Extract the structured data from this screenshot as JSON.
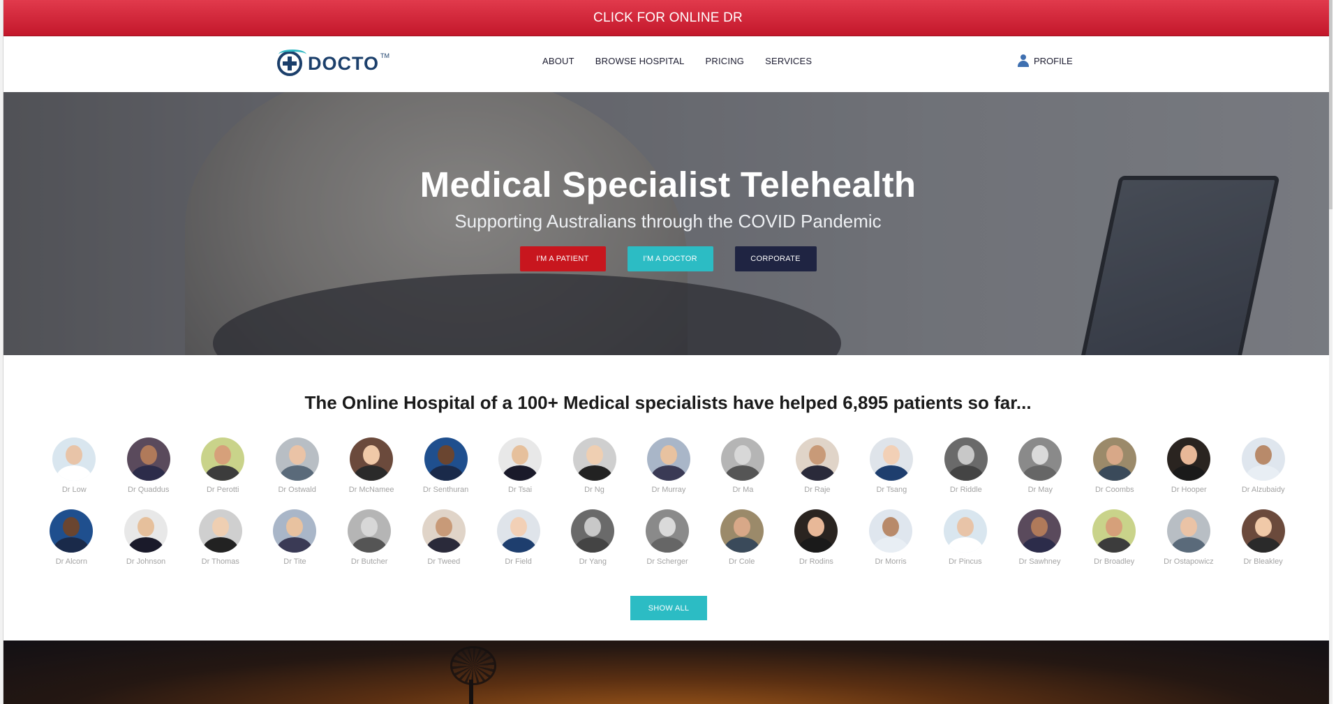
{
  "banner": {
    "text": "CLICK FOR ONLINE DR"
  },
  "nav": {
    "logo_text": "DOCTO",
    "logo_tm": "TM",
    "links": [
      "ABOUT",
      "BROWSE HOSPITAL",
      "PRICING",
      "SERVICES"
    ],
    "profile_label": "PROFILE"
  },
  "hero": {
    "title": "Medical Specialist Telehealth",
    "subtitle": "Supporting Australians through the COVID Pandemic",
    "buttons": {
      "patient": "I'M A PATIENT",
      "doctor": "I'M A DOCTOR",
      "corporate": "CORPORATE"
    }
  },
  "specialists": {
    "heading": "The Online Hospital of a 100+ Medical specialists have helped 6,895 patients so far...",
    "row1": [
      "Dr Low",
      "Dr Quaddus",
      "Dr Perotti",
      "Dr Ostwald",
      "Dr McNamee",
      "Dr Senthuran",
      "Dr Tsai",
      "Dr Ng",
      "Dr Murray",
      "Dr Ma",
      "Dr Raje",
      "Dr Tsang",
      "Dr Riddle",
      "Dr May",
      "Dr Coombs",
      "Dr Hooper",
      "Dr Alzubaidy"
    ],
    "row2": [
      "Dr Alcorn",
      "Dr Johnson",
      "Dr Thomas",
      "Dr Tite",
      "Dr Butcher",
      "Dr Tweed",
      "Dr Field",
      "Dr Yang",
      "Dr Scherger",
      "Dr Cole",
      "Dr Rodins",
      "Dr Morris",
      "Dr Pincus",
      "Dr Sawhney",
      "Dr Broadley",
      "Dr Ostapowicz",
      "Dr Bleakley"
    ],
    "show_all": "SHOW ALL"
  },
  "colors": {
    "banner_red": "#c3172b",
    "patient_red": "#c8161e",
    "doctor_teal": "#2cbcc4",
    "corporate_navy": "#1f2442",
    "brand_navy": "#1b3f6b"
  }
}
